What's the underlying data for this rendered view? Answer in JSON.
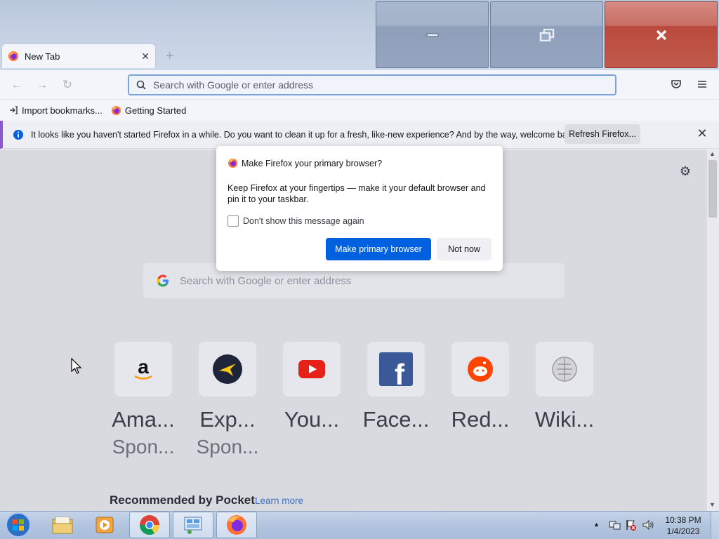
{
  "window": {
    "tab_title": "New Tab",
    "colors": {
      "close_red": "#c15a4c",
      "accent_blue": "#0061e0"
    }
  },
  "nav": {
    "url_placeholder": "Search with Google or enter address",
    "icons": [
      "back-arrow-icon",
      "forward-arrow-icon",
      "reload-icon",
      "pocket-icon",
      "menu-icon"
    ]
  },
  "bookmarks": {
    "items": [
      {
        "label": "Import bookmarks...",
        "icon": "import-icon"
      },
      {
        "label": "Getting Started",
        "icon": "firefox-icon"
      }
    ]
  },
  "notification": {
    "message": "It looks like you haven't started Firefox in a while. Do you want to clean it up for a fresh, like-new experience? And by the way, welcome back!",
    "button": "Refresh Firefox..."
  },
  "newtab": {
    "search_placeholder": "Search with Google or enter address",
    "tiles": [
      {
        "label": "Ama...",
        "sponsor": "Spon..."
      },
      {
        "label": "Exp...",
        "sponsor": "Spon..."
      },
      {
        "label": "You...",
        "sponsor": ""
      },
      {
        "label": "Face...",
        "sponsor": ""
      },
      {
        "label": "Red...",
        "sponsor": ""
      },
      {
        "label": "Wiki...",
        "sponsor": ""
      }
    ],
    "pocket_title": "Recommended by Pocket",
    "pocket_link": "Learn more"
  },
  "dialog": {
    "title": "Make Firefox your primary browser?",
    "body": "Keep Firefox at your fingertips — make it your default browser and pin it to your taskbar.",
    "checkbox_label": "Don't show this message again",
    "checkbox_checked": false,
    "primary_button": "Make primary browser",
    "secondary_button": "Not now"
  },
  "taskbar": {
    "time": "10:38 PM",
    "date": "1/4/2023",
    "apps": [
      "file-explorer-icon",
      "media-player-icon",
      "chrome-icon",
      "control-panel-icon",
      "firefox-icon"
    ]
  }
}
